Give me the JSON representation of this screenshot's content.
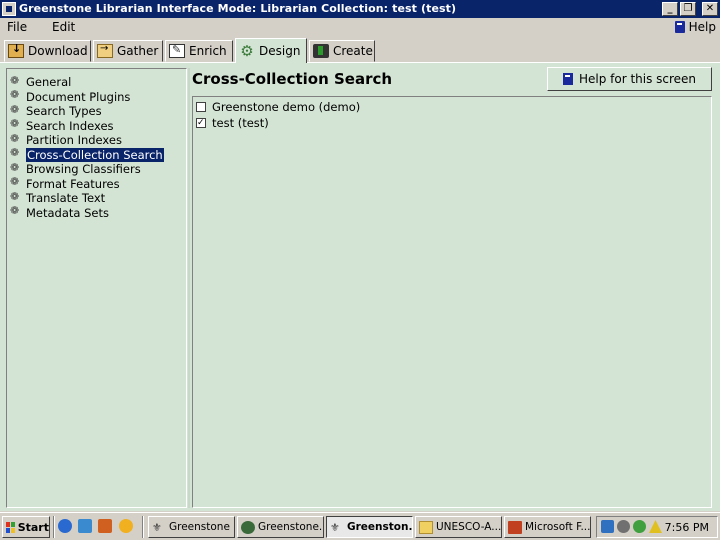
{
  "window": {
    "title": "Greenstone Librarian Interface  Mode: Librarian  Collection: test (test)"
  },
  "menubar": {
    "file": "File",
    "edit": "Edit",
    "help": "Help"
  },
  "tabs": [
    {
      "label": "Download",
      "icon": "download-icon"
    },
    {
      "label": "Gather",
      "icon": "gather-icon"
    },
    {
      "label": "Enrich",
      "icon": "enrich-icon"
    },
    {
      "label": "Design",
      "icon": "gear-icon",
      "active": true
    },
    {
      "label": "Create",
      "icon": "traffic-light-icon"
    }
  ],
  "sidebar": {
    "items": [
      {
        "label": "General"
      },
      {
        "label": "Document Plugins"
      },
      {
        "label": "Search Types"
      },
      {
        "label": "Search Indexes"
      },
      {
        "label": "Partition Indexes"
      },
      {
        "label": "Cross-Collection Search",
        "selected": true
      },
      {
        "label": "Browsing Classifiers"
      },
      {
        "label": "Format Features"
      },
      {
        "label": "Translate Text"
      },
      {
        "label": "Metadata Sets"
      }
    ]
  },
  "main": {
    "title": "Cross-Collection Search",
    "help_button": "Help for this screen",
    "collections": [
      {
        "label": "Greenstone demo (demo)",
        "checked": false
      },
      {
        "label": "test (test)",
        "checked": true
      }
    ]
  },
  "taskbar": {
    "start": "Start",
    "tasks": [
      {
        "label": "Greenstone ...",
        "active": false
      },
      {
        "label": "Greenstone...",
        "active": false
      },
      {
        "label": "Greenston...",
        "active": true
      },
      {
        "label": "UNESCO-A...",
        "active": false
      },
      {
        "label": "Microsoft F...",
        "active": false
      }
    ],
    "clock": "7:56 PM"
  }
}
